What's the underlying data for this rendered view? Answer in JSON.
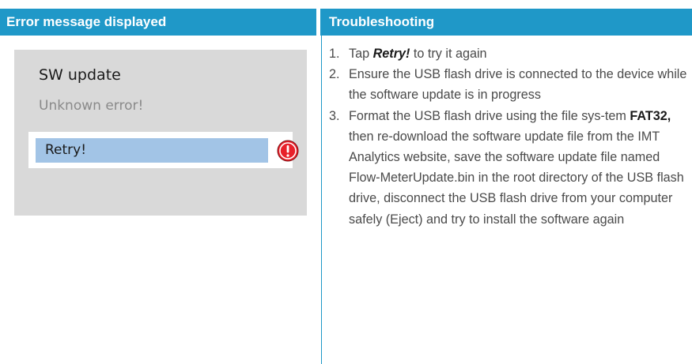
{
  "headers": {
    "left": "Error message displayed",
    "right": "Troubleshooting"
  },
  "screen": {
    "title": "SW update",
    "subtitle": "Unknown error!",
    "button_label": "Retry!",
    "icon": "error-icon",
    "icon_color": "#e8202a"
  },
  "steps": [
    {
      "num": "1.",
      "pre": "Tap ",
      "bold": "Retry!",
      "post": " to try it again"
    },
    {
      "num": "2.",
      "text": "Ensure the USB flash drive is connected to the device while the software update is in progress"
    },
    {
      "num": "3.",
      "pre": "Format the USB flash drive using the file sys-tem ",
      "bold": "FAT32,",
      "post": " then re-download the software update file from the IMT Analytics website, save the software update file named Flow-MeterUpdate.bin in the root directory of the USB flash drive, disconnect the USB flash drive from your computer safely (Eject) and try to install the software again"
    }
  ],
  "colors": {
    "header": "#1f98c8",
    "screen_bg": "#d9d9d9",
    "button_bg": "#a2c4e6"
  }
}
